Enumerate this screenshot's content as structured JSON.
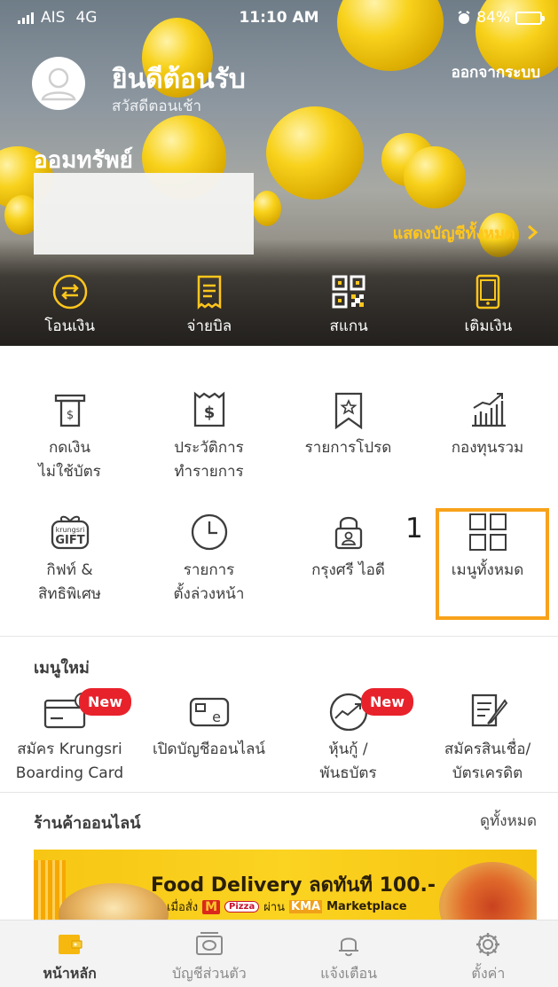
{
  "status_bar": {
    "carrier": "AIS",
    "network": "4G",
    "time": "11:10 AM",
    "battery": "84%",
    "battery_level": 0.84
  },
  "header": {
    "welcome": "ยินดีต้อนรับ",
    "greeting": "สวัสดีตอนเช้า",
    "logout": "ออกจากระบบ",
    "savings_title": "ออมทรัพย์",
    "show_all_accounts": "แสดงบัญชีทั้งหมด",
    "show_all_chevron": "chevron-right-icon"
  },
  "quick_actions": [
    {
      "label": "โอนเงิน",
      "icon": "transfer-icon"
    },
    {
      "label": "จ่ายบิล",
      "icon": "bill-icon"
    },
    {
      "label": "สแกน",
      "icon": "qr-scan-icon"
    },
    {
      "label": "เติมเงิน",
      "icon": "phone-topup-icon"
    }
  ],
  "menu": [
    {
      "line1": "กดเงิน",
      "line2": "ไม่ใช้บัตร",
      "icon": "cardless-withdraw-icon"
    },
    {
      "line1": "ประวัติการ",
      "line2": "ทำรายการ",
      "icon": "receipt-icon"
    },
    {
      "line1": "รายการโปรด",
      "line2": "",
      "icon": "favorite-bookmark-icon"
    },
    {
      "line1": "กองทุนรวม",
      "line2": "",
      "icon": "fund-chart-icon"
    },
    {
      "line1": "กิฟท์ &",
      "line2": "สิทธิพิเศษ",
      "icon": "gift-icon",
      "gift_top": "krungsri",
      "gift_bottom": "GIFT"
    },
    {
      "line1": "รายการ",
      "line2": "ตั้งล่วงหน้า",
      "icon": "clock-icon"
    },
    {
      "line1": "กรุงศรี ไอดี",
      "line2": "",
      "icon": "lock-id-icon"
    },
    {
      "line1": "เมนูทั้งหมด",
      "line2": "",
      "icon": "all-menu-grid-icon"
    }
  ],
  "annotation": "1",
  "new_menu": {
    "title": "เมนูใหม่",
    "items": [
      {
        "line1": "สมัคร Krungsri",
        "line2": "Boarding Card",
        "icon": "card-icon",
        "badge": "New"
      },
      {
        "line1": "เปิดบัญชีออนไลน์",
        "line2": "",
        "icon": "e-account-icon",
        "badge": "",
        "e_letter": "e"
      },
      {
        "line1": "หุ้นกู้ /",
        "line2": "พันธบัตร",
        "icon": "bond-trend-icon",
        "badge": "New"
      },
      {
        "line1": "สมัครสินเชื่อ/",
        "line2": "บัตรเครดิต",
        "icon": "loan-form-icon",
        "badge": ""
      }
    ]
  },
  "shop": {
    "title": "ร้านค้าออนไลน์",
    "see_all": "ดูทั้งหมด",
    "banner": {
      "headline": "Food Delivery ลดทันที 100.-",
      "sub_prefix": "เมื่อสั่ง",
      "mc_logo": "M",
      "pizza_logo": "Pizza",
      "sub_via": "ผ่าน",
      "kma_logo": "KMA",
      "sub_suffix": "Marketplace"
    }
  },
  "tabs": [
    {
      "label": "หน้าหลัก",
      "icon": "home-wallet-icon",
      "active": true
    },
    {
      "label": "บัญชีส่วนตัว",
      "icon": "money-icon",
      "active": false
    },
    {
      "label": "แจ้งเตือน",
      "icon": "bell-icon",
      "active": false
    },
    {
      "label": "ตั้งค่า",
      "icon": "gear-icon",
      "active": false
    }
  ],
  "colors": {
    "accent": "#ffc61c",
    "highlight": "#f7a21b",
    "badge": "#e8222b",
    "icon": "#3d3d3d"
  }
}
